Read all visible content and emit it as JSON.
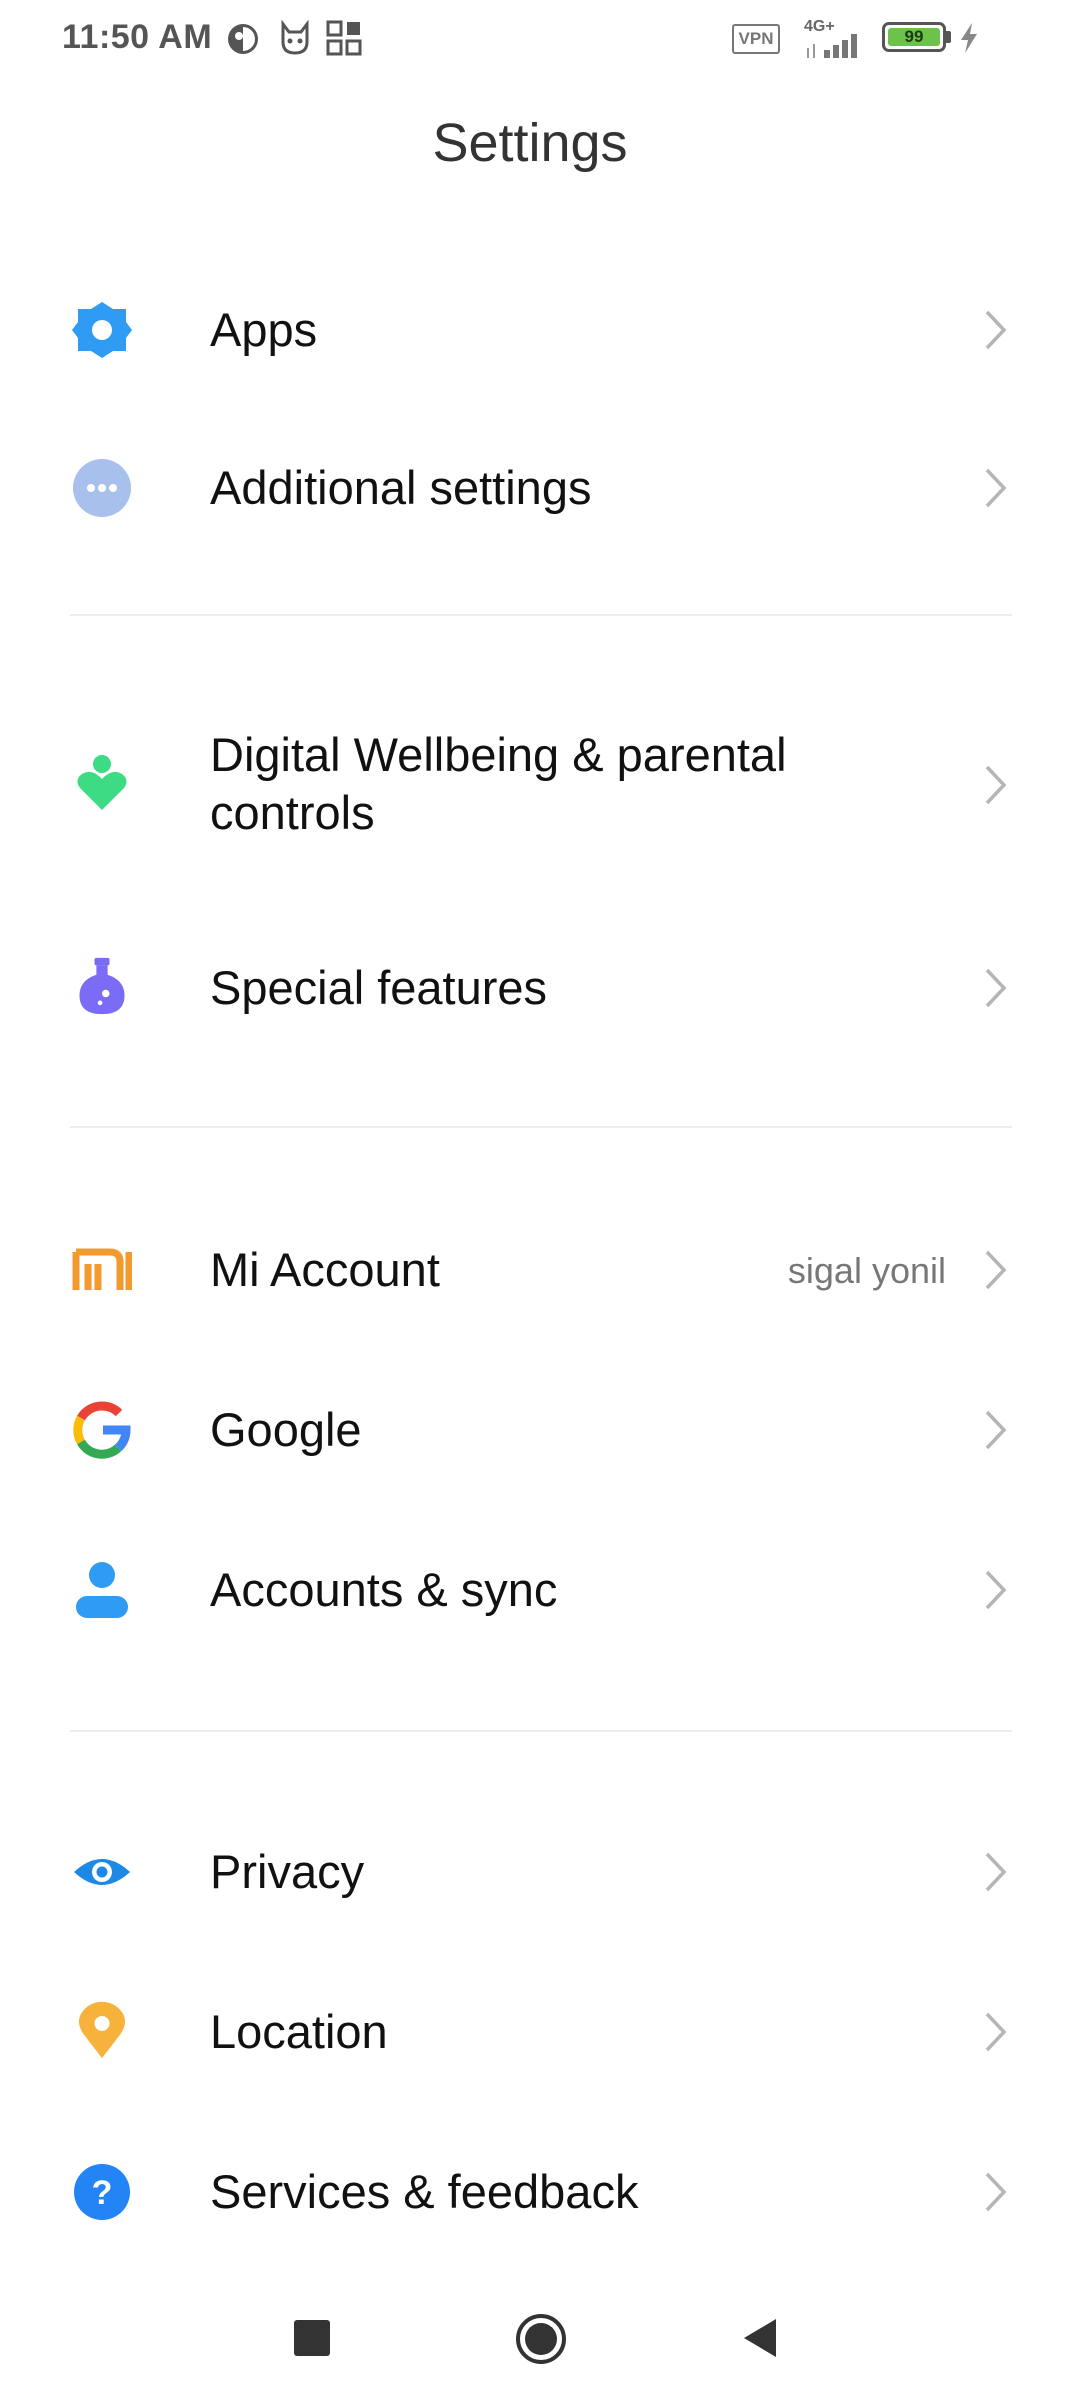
{
  "status_bar": {
    "time": "11:50 AM",
    "network": "4G+",
    "vpn_label": "VPN",
    "battery_level": "99",
    "icons": [
      "brightness-icon",
      "cat-face-icon",
      "apps-grid-icon",
      "vpn-icon",
      "signal-icon",
      "battery-icon",
      "charging-icon"
    ]
  },
  "header": {
    "title": "Settings"
  },
  "settings": {
    "apps": {
      "label": "Apps",
      "icon": "gear-icon"
    },
    "additional": {
      "label": "Additional settings",
      "icon": "more-dots-icon"
    },
    "wellbeing": {
      "label_line1": "Digital Wellbeing & parental",
      "label_line2": "controls",
      "icon": "heart-person-icon"
    },
    "special": {
      "label": "Special features",
      "icon": "flask-icon"
    },
    "mi_account": {
      "label": "Mi Account",
      "value": "sigal yonil",
      "icon": "mi-logo-icon"
    },
    "google": {
      "label": "Google",
      "icon": "google-g-icon"
    },
    "accounts_sync": {
      "label": "Accounts & sync",
      "icon": "person-icon"
    },
    "privacy": {
      "label": "Privacy",
      "icon": "eye-icon"
    },
    "location": {
      "label": "Location",
      "icon": "location-pin-icon"
    },
    "services": {
      "label": "Services & feedback",
      "icon": "help-icon"
    }
  },
  "colors": {
    "gear": "#2f9bf3",
    "more": "#a8c0ec",
    "wellbeing": "#3ddc84",
    "flask": "#7b6cf6",
    "mi": "#f29a2e",
    "person": "#2f9bf3",
    "eye": "#1e88e5",
    "pin": "#f6b23b",
    "help": "#2284f5",
    "battery_fill": "#6cc24a"
  },
  "nav_bar": {
    "buttons": [
      "recent-apps-button",
      "home-button",
      "back-button"
    ]
  }
}
